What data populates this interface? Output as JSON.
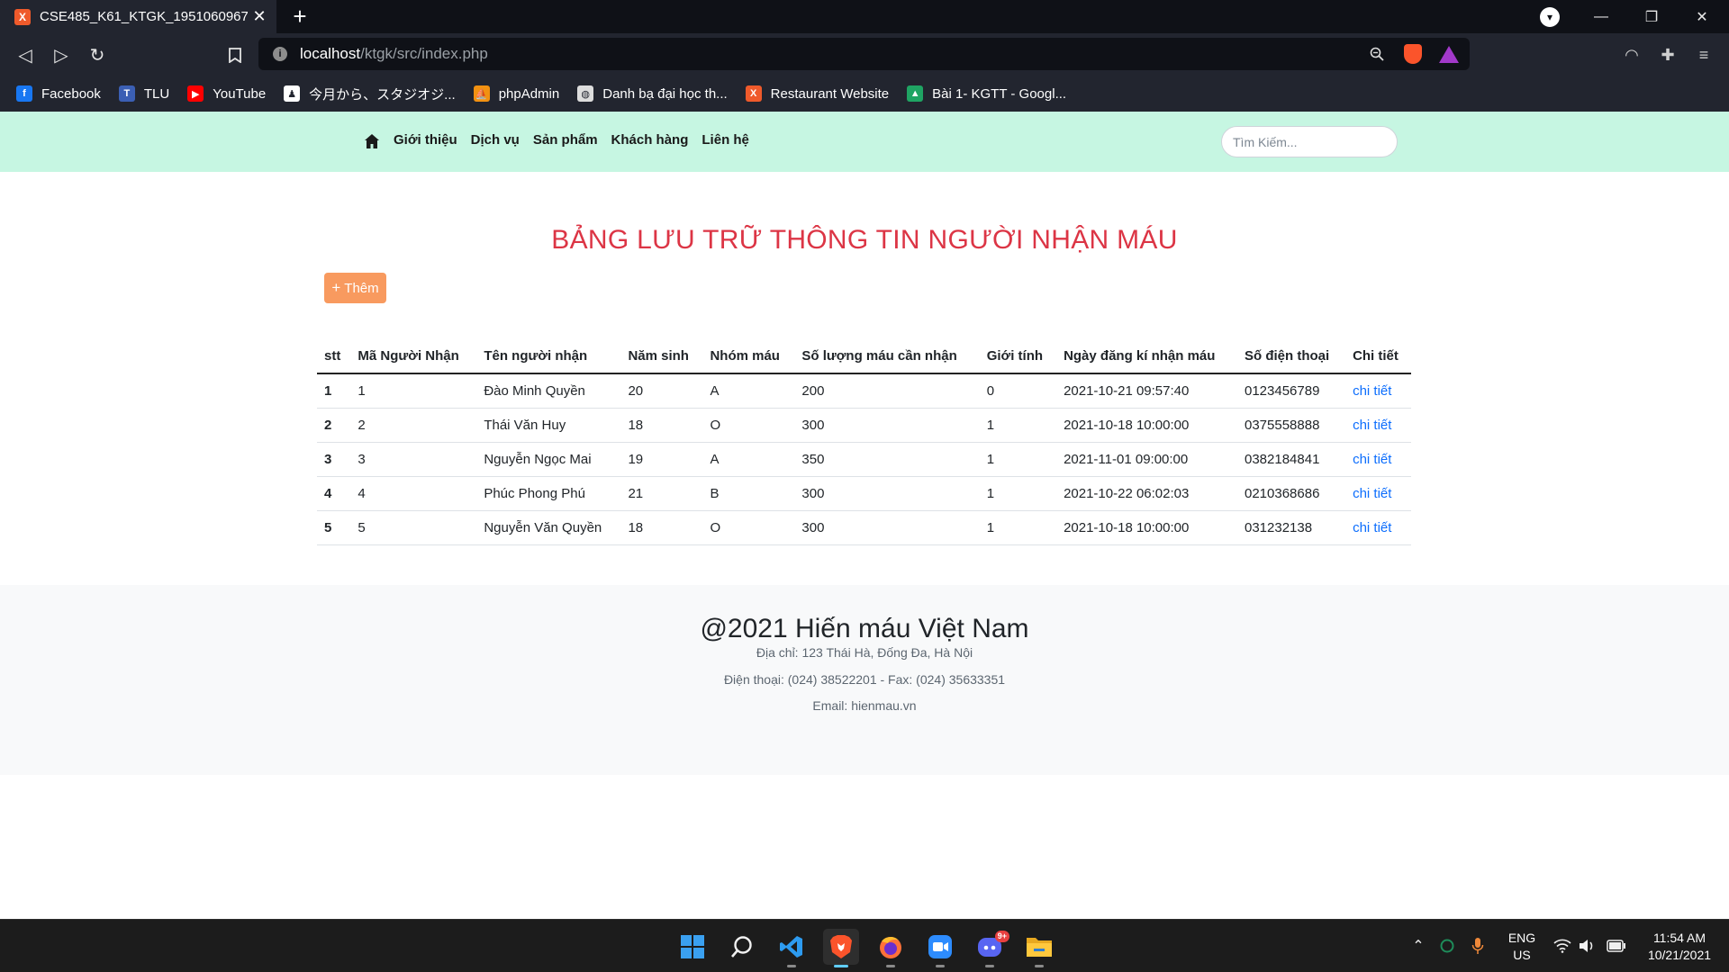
{
  "browser": {
    "tab_title": "CSE485_K61_KTGK_1951060967",
    "url_host": "localhost",
    "url_path": "/ktgk/src/index.php",
    "bookmarks": [
      {
        "label": "Facebook",
        "icon": "facebook-icon",
        "color": "#1877f2",
        "glyph": "f"
      },
      {
        "label": "TLU",
        "icon": "tlu-icon",
        "color": "#3b5fb4",
        "glyph": "T"
      },
      {
        "label": "YouTube",
        "icon": "youtube-icon",
        "color": "#ff0000",
        "glyph": "▶"
      },
      {
        "label": "今月から、スタジオジ...",
        "icon": "studio-icon",
        "color": "#ffffff",
        "glyph": "♟"
      },
      {
        "label": "phpAdmin",
        "icon": "phpmyadmin-icon",
        "color": "#f29111",
        "glyph": "⛵"
      },
      {
        "label": "Danh bạ đại học th...",
        "icon": "globe-icon",
        "color": "#dddddd",
        "glyph": "◍"
      },
      {
        "label": "Restaurant Website",
        "icon": "xampp-icon",
        "color": "#ef5a2b",
        "glyph": "X"
      },
      {
        "label": "Bài 1- KGTT - Googl...",
        "icon": "google-drive-icon",
        "color": "#1fa463",
        "glyph": "▲"
      }
    ]
  },
  "navbar": {
    "links": [
      "Giới thiệu",
      "Dịch vụ",
      "Sản phẩm",
      "Khách hàng",
      "Liên hệ"
    ],
    "search_placeholder": "Tìm Kiếm..."
  },
  "main": {
    "heading": "BẢNG LƯU TRỮ THÔNG TIN NGƯỜI NHẬN MÁU",
    "add_button": "Thêm",
    "table": {
      "columns": [
        "stt",
        "Mã Người Nhận",
        "Tên người nhận",
        "Năm sinh",
        "Nhóm máu",
        "Số lượng máu cần nhận",
        "Giới tính",
        "Ngày đăng kí nhận máu",
        "Số điện thoại",
        "Chi tiết"
      ],
      "rows": [
        [
          "1",
          "1",
          "Đào Minh Quyền",
          "20",
          "A",
          "200",
          "0",
          "2021-10-21 09:57:40",
          "0123456789",
          "chi tiết"
        ],
        [
          "2",
          "2",
          "Thái Văn Huy",
          "18",
          "O",
          "300",
          "1",
          "2021-10-18 10:00:00",
          "0375558888",
          "chi tiết"
        ],
        [
          "3",
          "3",
          "Nguyễn Ngọc Mai",
          "19",
          "A",
          "350",
          "1",
          "2021-11-01 09:00:00",
          "0382184841",
          "chi tiết"
        ],
        [
          "4",
          "4",
          "Phúc Phong Phú",
          "21",
          "B",
          "300",
          "1",
          "2021-10-22 06:02:03",
          "0210368686",
          "chi tiết"
        ],
        [
          "5",
          "5",
          "Nguyễn Văn Quyền",
          "18",
          "O",
          "300",
          "1",
          "2021-10-18 10:00:00",
          "031232138",
          "chi tiết"
        ]
      ]
    }
  },
  "footer": {
    "title": "@2021 Hiến máu Việt Nam",
    "address": "Địa chỉ: 123 Thái Hà, Đống Đa, Hà Nội",
    "phone": "Điện thoại: (024) 38522201 - Fax: (024) 35633351",
    "email": "Email: hienmau.vn"
  },
  "taskbar": {
    "lang_line1": "ENG",
    "lang_line2": "US",
    "time": "11:54 AM",
    "date": "10/21/2021",
    "discord_badge": "9+"
  },
  "colors": {
    "navbar_bg": "#c6f6e2",
    "heading": "#dc3545",
    "add_button": "#f89a5f",
    "link": "#0d6efd",
    "footer_bg": "#f8f9fa"
  }
}
